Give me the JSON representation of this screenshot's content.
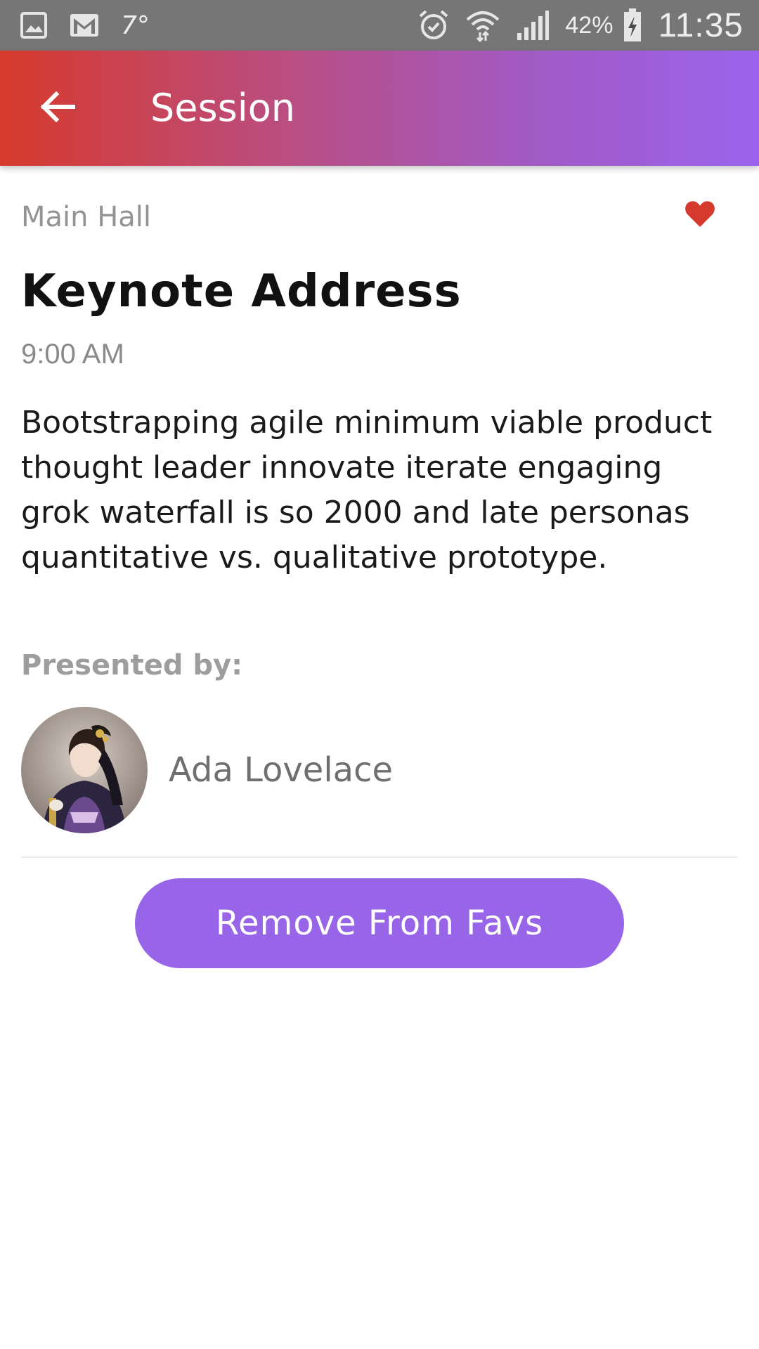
{
  "status_bar": {
    "temperature": "7°",
    "battery_percent": "42%",
    "time": "11:35",
    "icons": [
      "gallery-icon",
      "gmail-icon",
      "alarm-icon",
      "wifi-icon",
      "signal-icon",
      "battery-charging-icon"
    ]
  },
  "app_bar": {
    "title": "Session",
    "back_icon": "arrow-back-icon"
  },
  "session": {
    "room": "Main Hall",
    "is_favorite": true,
    "title": "Keynote Address",
    "time": "9:00 AM",
    "description": "Bootstrapping agile minimum viable product thought leader innovate iterate engaging grok waterfall is so 2000 and late personas quantitative vs. qualitative prototype.",
    "presented_by_label": "Presented by:",
    "speaker": {
      "name": "Ada Lovelace"
    },
    "fav_button_label": "Remove From Favs"
  },
  "colors": {
    "accent": "#9965e8",
    "favorite": "#d63a2c",
    "appbar_start": "#d63a2c",
    "appbar_end": "#9b63ec"
  }
}
